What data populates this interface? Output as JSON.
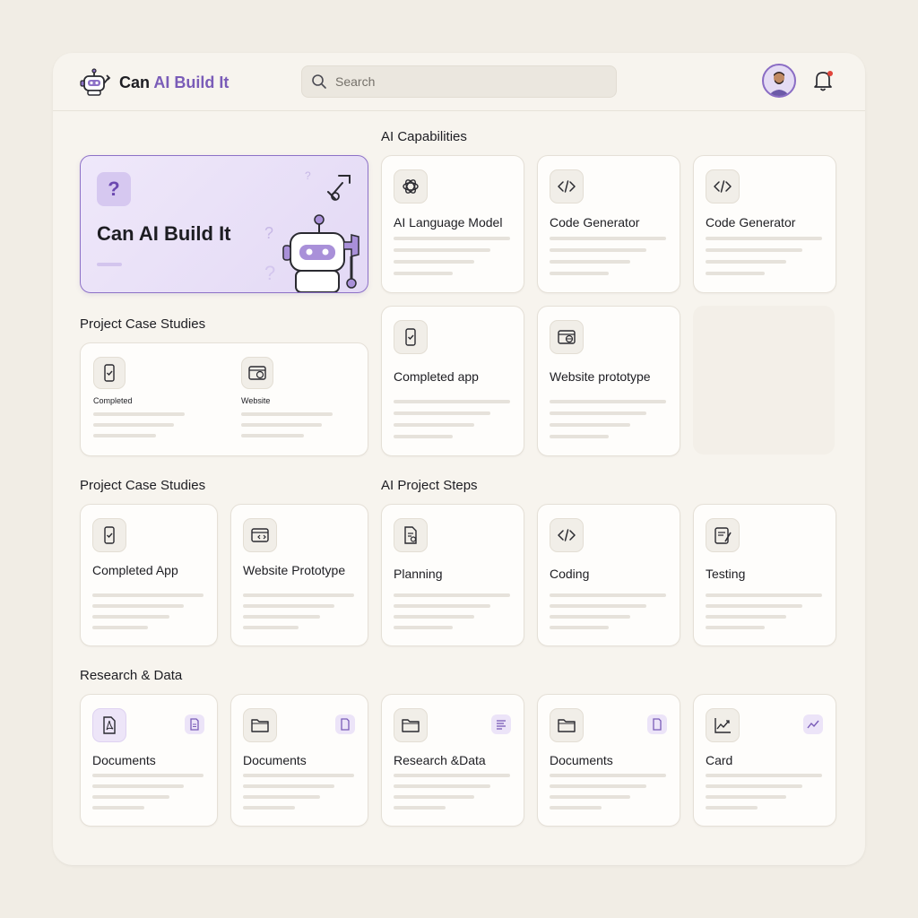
{
  "app": {
    "name_part1": "Can",
    "name_part2": "AI Build It"
  },
  "search": {
    "placeholder": "Search"
  },
  "hero": {
    "title": "Can AI Build It",
    "badge": "?"
  },
  "sections": {
    "ai_capabilities": "AI Capabilities",
    "project_case_studies_top": "Project Case Studies",
    "project_case_studies_bottom": "Project Case Studies",
    "ai_project_steps": "AI Project Steps",
    "research_data": "Research & Data"
  },
  "capabilities": [
    {
      "title": "AI Language Model",
      "icon": "openai-knot-icon"
    },
    {
      "title": "Code Generator",
      "icon": "code-icon"
    },
    {
      "title": "Code Generator",
      "icon": "code-icon"
    },
    {
      "title": "Completed app",
      "icon": "phone-check-icon"
    },
    {
      "title": "Website prototype",
      "icon": "browser-globe-icon"
    }
  ],
  "case_studies_top": [
    {
      "label": "Completed",
      "icon": "phone-check-icon"
    },
    {
      "label": "Website",
      "icon": "browser-globe-icon"
    }
  ],
  "case_studies_bottom": [
    {
      "title": "Completed App",
      "icon": "phone-check-icon"
    },
    {
      "title": "Website Prototype",
      "icon": "browser-code-icon"
    }
  ],
  "project_steps": [
    {
      "title": "Planning",
      "icon": "document-plan-icon"
    },
    {
      "title": "Coding",
      "icon": "code-icon"
    },
    {
      "title": "Testing",
      "icon": "checklist-icon"
    }
  ],
  "research": [
    {
      "title": "Documents",
      "icon": "pdf-icon",
      "badge": "doc-badge-icon"
    },
    {
      "title": "Documents",
      "icon": "folder-icon",
      "badge": "file-badge-icon"
    },
    {
      "title": "Research &Data",
      "icon": "folder-icon",
      "badge": "list-badge-icon"
    },
    {
      "title": "Documents",
      "icon": "folder-icon",
      "badge": "file-badge-icon"
    },
    {
      "title": "Card",
      "icon": "chart-line-icon",
      "badge": "chart-badge-icon"
    }
  ],
  "colors": {
    "accent": "#7a5cb8",
    "background": "#f1ede5",
    "panel": "#f7f4ee",
    "card": "#fefdfb",
    "notification": "#e0443a"
  }
}
